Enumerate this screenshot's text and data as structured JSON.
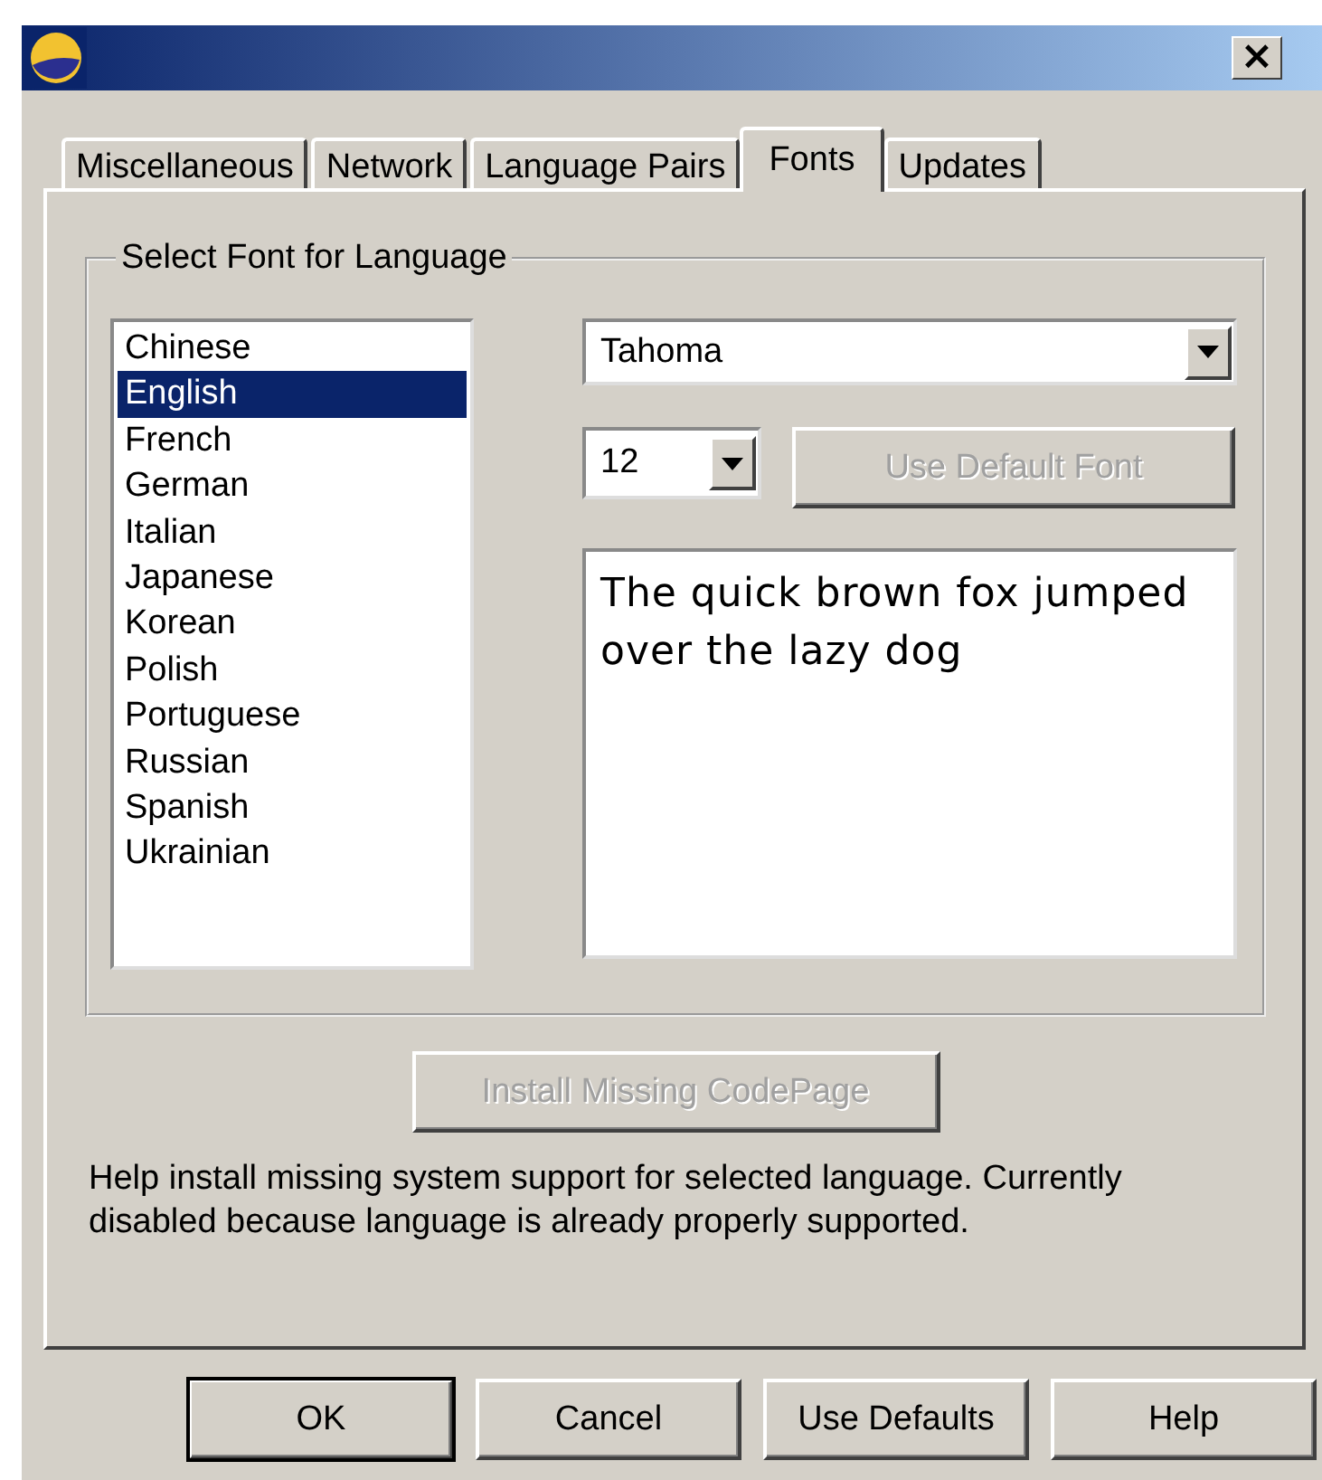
{
  "window": {
    "close": "×"
  },
  "tabs": [
    {
      "label": "Miscellaneous",
      "selected": false
    },
    {
      "label": "Network",
      "selected": false
    },
    {
      "label": "Language Pairs",
      "selected": false
    },
    {
      "label": "Fonts",
      "selected": true
    },
    {
      "label": "Updates",
      "selected": false
    }
  ],
  "group": {
    "title": "Select Font for Language"
  },
  "languages": [
    {
      "label": "Chinese",
      "selected": false
    },
    {
      "label": "English",
      "selected": true
    },
    {
      "label": "French",
      "selected": false
    },
    {
      "label": "German",
      "selected": false
    },
    {
      "label": "Italian",
      "selected": false
    },
    {
      "label": "Japanese",
      "selected": false
    },
    {
      "label": "Korean",
      "selected": false
    },
    {
      "label": "Polish",
      "selected": false
    },
    {
      "label": "Portuguese",
      "selected": false
    },
    {
      "label": "Russian",
      "selected": false
    },
    {
      "label": "Spanish",
      "selected": false
    },
    {
      "label": "Ukrainian",
      "selected": false
    }
  ],
  "font_select": {
    "value": "Tahoma"
  },
  "size_select": {
    "value": "12"
  },
  "default_font_button": {
    "label": "Use Default Font",
    "disabled": true
  },
  "preview": {
    "text": "The quick brown fox jumped over the lazy dog"
  },
  "install_button": {
    "label": "Install Missing CodePage",
    "disabled": true
  },
  "help_text": "Help install missing system support for selected language. Currently disabled because language is already properly supported.",
  "buttons": [
    {
      "label": "OK",
      "default": true
    },
    {
      "label": "Cancel",
      "default": false
    },
    {
      "label": "Use Defaults",
      "default": false
    },
    {
      "label": "Help",
      "default": false
    }
  ]
}
